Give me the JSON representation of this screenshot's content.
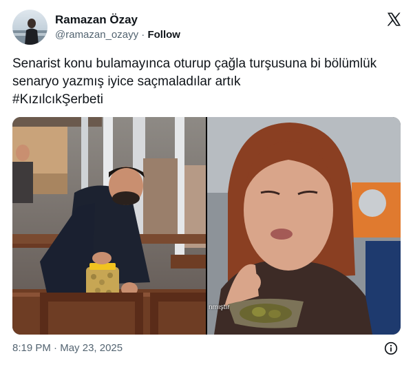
{
  "author": {
    "name": "Ramazan Özay",
    "handle": "@ramazan_ozayy",
    "separator": "·",
    "follow_label": "Follow"
  },
  "tweet": {
    "text": "Senarist konu bulamayınca oturup çağla turşusuna bi bölümlük senaryo yazmış iyice saçmaladılar artık\n#KızılcıkŞerbeti"
  },
  "media": {
    "left_image": "man-opening-pickle-jar-in-restaurant",
    "right_image": "woman-eating-pickle",
    "subtitle_fragment": "nmıştır"
  },
  "footer": {
    "time": "8:19 PM",
    "separator": "·",
    "date": "May 23, 2025"
  },
  "icons": {
    "x": "x-logo-icon",
    "info": "info-icon"
  },
  "colors": {
    "text": "#0f1419",
    "secondary": "#536471"
  }
}
